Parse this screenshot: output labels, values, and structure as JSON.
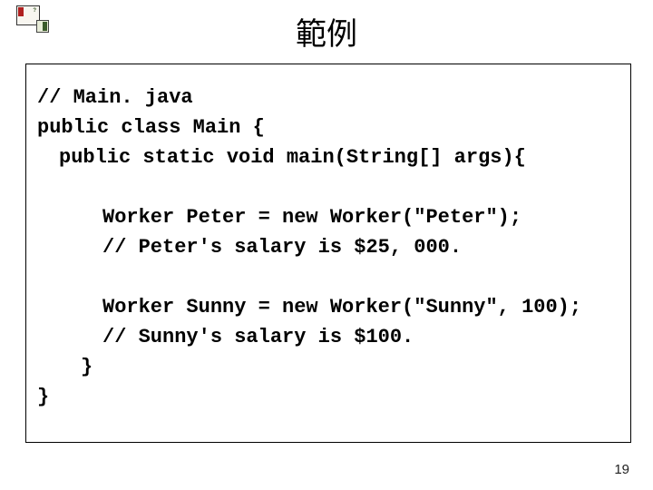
{
  "title": "範例",
  "code": {
    "line1": "// Main. java",
    "line2": "public class Main {",
    "line3": "public static void main(String[] args){",
    "line4": "Worker Peter = new Worker(\"Peter\");",
    "line5": "// Peter's salary is $25, 000.",
    "line6": "Worker Sunny = new Worker(\"Sunny\", 100);",
    "line7": "// Sunny's salary is $100.",
    "line8": "}",
    "line9": "}"
  },
  "pageNumber": "19",
  "iconLabel": "?"
}
